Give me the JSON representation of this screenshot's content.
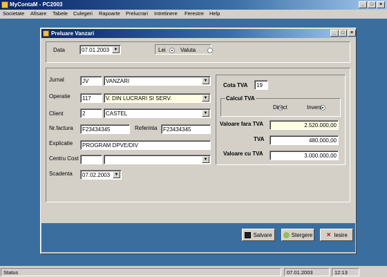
{
  "app": {
    "title": "MyContaM - PC2003",
    "min": "_",
    "max": "□",
    "close": "×"
  },
  "menu": [
    "Societate",
    "Afisare",
    "Tabele",
    "Culegeri",
    "Rapoarte",
    "Prelucrari",
    "Intretinere",
    "Ferestre",
    "Help"
  ],
  "dialog": {
    "title": "Preluare Vanzari",
    "min": "_",
    "max": "□",
    "close": "×",
    "data_label": "Data",
    "data_value": "07.01.2003",
    "lei_label": "Lei",
    "valuta_label": "Valuta",
    "currency_selected": "Lei",
    "jurnal_label": "Jurnal",
    "jurnal_code": "JV",
    "jurnal_name": "VANZARI",
    "operatie_label": "Operatie",
    "operatie_code": "117",
    "operatie_name": "V. DIN LUCRARI SI SERV.",
    "client_label": "Client",
    "client_code": "2",
    "client_name": "CASTEL",
    "nrfactura_label": "Nr.factura",
    "nrfactura_value": "F23434345",
    "referinta_label": "Referinta",
    "referinta_value": "F23434345",
    "explicatie_label": "Explicatie",
    "explicatie_value": "PROGRAM DPVE/DIV",
    "centrucost_label": "Centru Cost",
    "centrucost_code": "",
    "centrucost_name": "",
    "scadenta_label": "Scadenta",
    "scadenta_value": "07.02.2003",
    "cota_tva_label": "Cota TVA",
    "cota_tva_value": "19",
    "calcul_tva_label": "Calcul TVA",
    "direct_label": "Direct",
    "invers_label": "Invers",
    "calcul_selected": "Invers",
    "val_fara_tva_label": "Valoare fara TVA",
    "val_fara_tva_value": "2.520.000,00",
    "tva_label": "TVA",
    "tva_value": "480.000,00",
    "val_cu_tva_label": "Valoare cu TVA",
    "val_cu_tva_value": "3.000.000,00",
    "buttons": {
      "salvare": "Salvare",
      "stergere": "Stergere",
      "iesire": "Iesire"
    }
  },
  "status": {
    "label": "Status",
    "date": "07.01.2003",
    "time": "12:13"
  }
}
